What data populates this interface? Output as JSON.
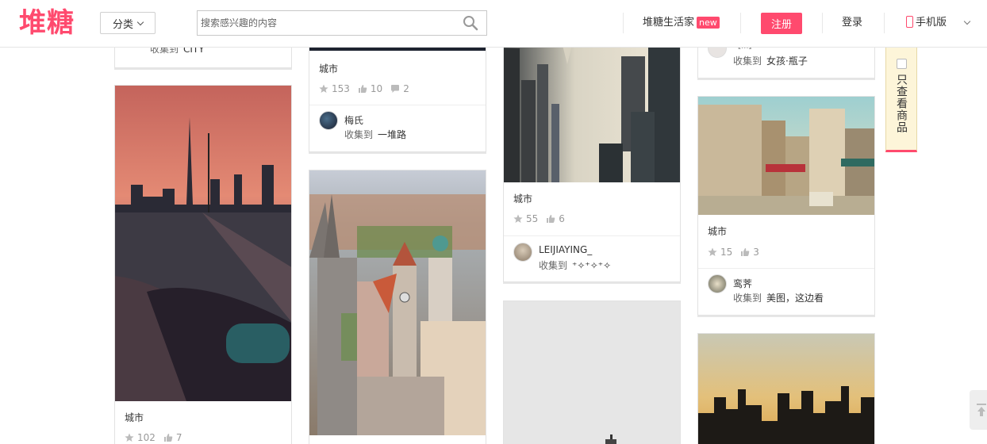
{
  "header": {
    "logo": "堆糖",
    "category_label": "分类",
    "search_placeholder": "搜索感兴趣的内容",
    "life_label": "堆糖生活家",
    "new_badge": "new",
    "register_label": "注册",
    "login_label": "登录",
    "mobile_label": "手机版"
  },
  "side_filter": {
    "label": "只查看商品"
  },
  "collect_prefix": "收集到",
  "cards": [
    {
      "partial_collect": "CITY"
    },
    {
      "title": "城市",
      "stars": "102",
      "likes": "7"
    },
    {
      "title": "城市",
      "stars": "153",
      "likes": "10",
      "comments": "2",
      "user": "梅氏",
      "album": "一堆路"
    },
    {
      "partial": ""
    },
    {
      "title": "城市",
      "stars": "55",
      "likes": "6",
      "user": "LEIJIAYING_",
      "album": "⁺✧⁺✧⁺✧"
    },
    {
      "partial": ""
    },
    {
      "partial_user": "【...】",
      "album": "女孩·瓶子"
    },
    {
      "title": "城市",
      "stars": "15",
      "likes": "3",
      "user": "鸾荠",
      "album": "美图，这边看"
    },
    {
      "partial": ""
    }
  ],
  "colors": {
    "brand": "#ff4a6e"
  }
}
